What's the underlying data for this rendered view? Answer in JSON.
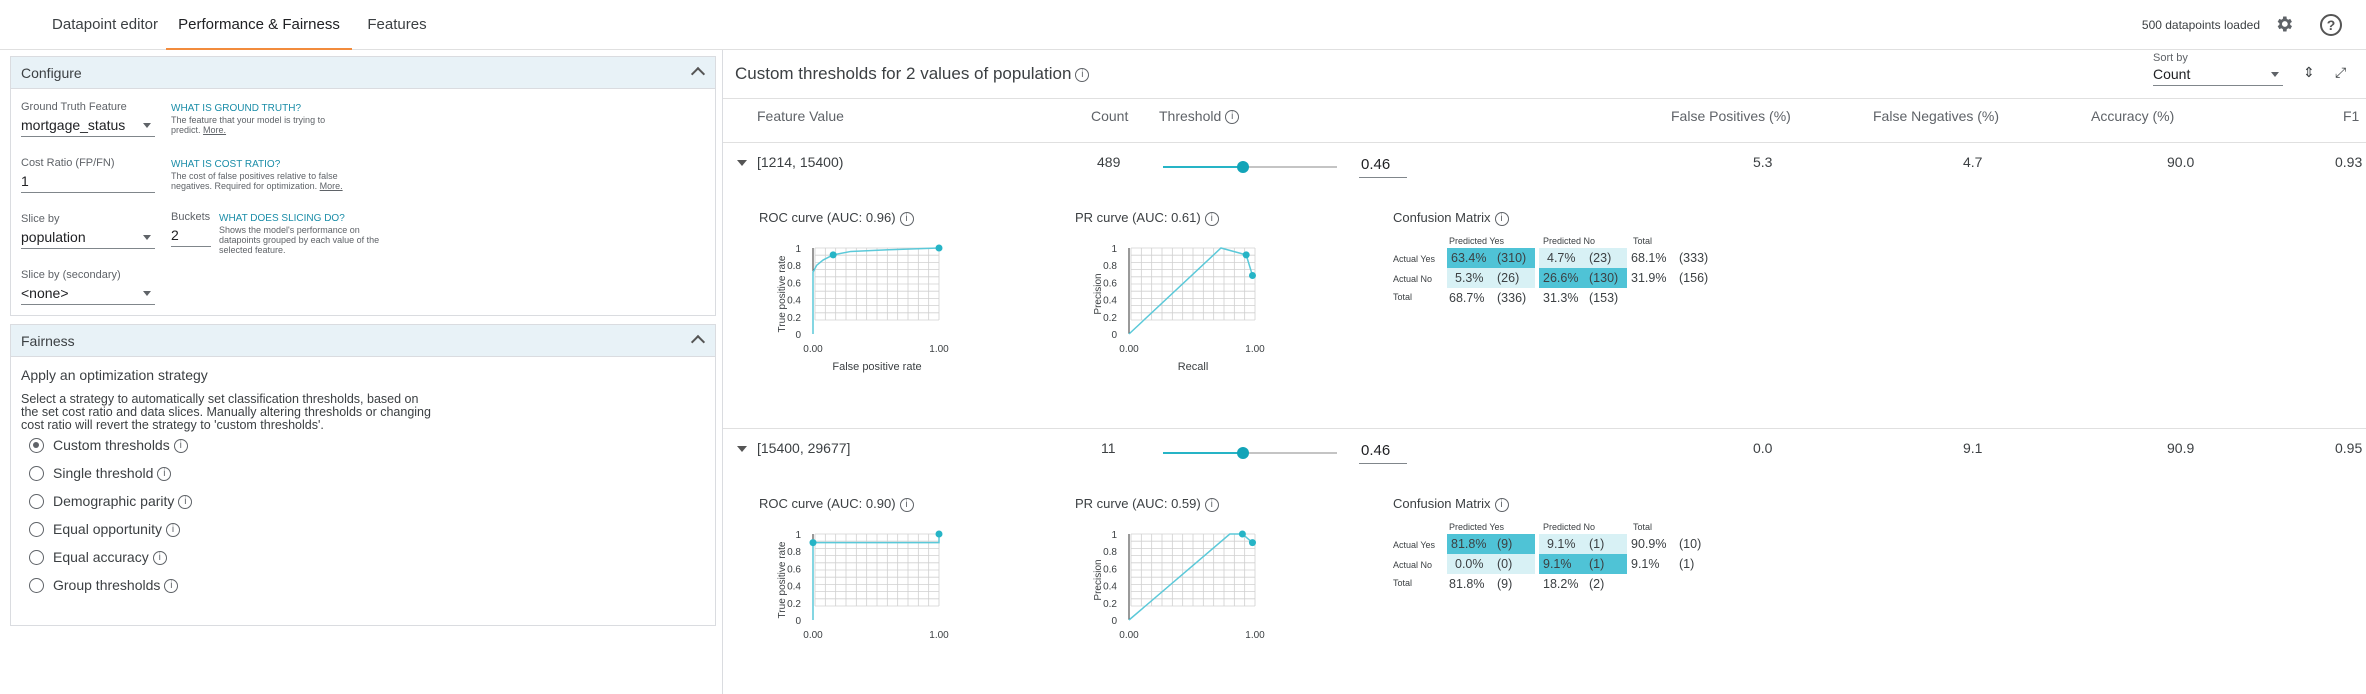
{
  "tabs": [
    "Datapoint editor",
    "Performance & Fairness",
    "Features"
  ],
  "status": {
    "loaded_text": "500 datapoints loaded",
    "settings_icon": "gear-icon",
    "help_icon": "help-icon"
  },
  "configure": {
    "title": "Configure",
    "gt_label": "Ground Truth Feature",
    "gt_value": "mortgage_status",
    "gt_what": "WHAT IS GROUND TRUTH?",
    "gt_desc1": "The feature that your model is trying to",
    "gt_desc2": "predict.",
    "more": "More.",
    "cost_label": "Cost Ratio (FP/FN)",
    "cost_value": "1",
    "cost_what": "WHAT IS COST RATIO?",
    "cost_desc1": "The cost of false positives relative to false",
    "cost_desc2": "negatives. Required for optimization.",
    "slice_label": "Slice by",
    "slice_value": "population",
    "buckets_label": "Buckets",
    "buckets_value": "2",
    "slice_what": "WHAT DOES SLICING DO?",
    "slice_desc1": "Shows the model's performance on",
    "slice_desc2": "datapoints grouped by each value of the",
    "slice_desc3": "selected feature.",
    "slice2_label": "Slice by (secondary)",
    "slice2_value": "<none>"
  },
  "fairness": {
    "title": "Fairness",
    "heading": "Apply an optimization strategy",
    "desc1": "Select a strategy to automatically set classification thresholds, based on",
    "desc2": "the set cost ratio and data slices. Manually altering thresholds or changing",
    "desc3": "cost ratio will revert the strategy to 'custom thresholds'.",
    "options": [
      "Custom thresholds",
      "Single threshold",
      "Demographic parity",
      "Equal opportunity",
      "Equal accuracy",
      "Group thresholds"
    ],
    "selected": "Custom thresholds"
  },
  "main": {
    "title": "Custom thresholds for 2 values of population",
    "sort_label": "Sort by",
    "sort_value": "Count",
    "columns": [
      "Feature Value",
      "Count",
      "Threshold",
      "False Positives (%)",
      "False Negatives (%)",
      "Accuracy (%)",
      "F1"
    ]
  },
  "rows": [
    {
      "feature": "[1214, 15400)",
      "count": "489",
      "threshold": "0.46",
      "threshold_value": 0.46,
      "fp": "5.3",
      "fn": "4.7",
      "acc": "90.0",
      "f1": "0.93",
      "roc_title": "ROC curve (AUC: 0.96)",
      "pr_title": "PR curve (AUC: 0.61)",
      "cm_title": "Confusion Matrix",
      "cm": {
        "h_pred_yes": "Predicted Yes",
        "h_pred_no": "Predicted No",
        "h_total": "Total",
        "r_yes": "Actual Yes",
        "r_no": "Actual No",
        "r_total": "Total",
        "yy_p": "63.4%",
        "yy_c": "(310)",
        "yn_p": "4.7%",
        "yn_c": "(23)",
        "yt_p": "68.1%",
        "yt_c": "(333)",
        "ny_p": "5.3%",
        "ny_c": "(26)",
        "nn_p": "26.6%",
        "nn_c": "(130)",
        "nt_p": "31.9%",
        "nt_c": "(156)",
        "ty_p": "68.7%",
        "ty_c": "(336)",
        "tn_p": "31.3%",
        "tn_c": "(153)"
      }
    },
    {
      "feature": "[15400, 29677]",
      "count": "11",
      "threshold": "0.46",
      "threshold_value": 0.46,
      "fp": "0.0",
      "fn": "9.1",
      "acc": "90.9",
      "f1": "0.95",
      "roc_title": "ROC curve (AUC: 0.90)",
      "pr_title": "PR curve (AUC: 0.59)",
      "cm_title": "Confusion Matrix",
      "cm": {
        "h_pred_yes": "Predicted Yes",
        "h_pred_no": "Predicted No",
        "h_total": "Total",
        "r_yes": "Actual Yes",
        "r_no": "Actual No",
        "r_total": "Total",
        "yy_p": "81.8%",
        "yy_c": "(9)",
        "yn_p": "9.1%",
        "yn_c": "(1)",
        "yt_p": "90.9%",
        "yt_c": "(10)",
        "ny_p": "0.0%",
        "ny_c": "(0)",
        "nn_p": "9.1%",
        "nn_c": "(1)",
        "nt_p": "9.1%",
        "nt_c": "(1)",
        "ty_p": "81.8%",
        "ty_c": "(9)",
        "tn_p": "18.2%",
        "tn_c": "(2)"
      }
    }
  ],
  "axes": {
    "roc_ylabel": "True positive rate",
    "roc_xlabel": "False positive rate",
    "pr_ylabel": "Precision",
    "pr_xlabel": "Recall",
    "yticks": [
      "1",
      "0.8",
      "0.6",
      "0.4",
      "0.2",
      "0"
    ],
    "xticks": [
      "0.00",
      "1.00"
    ]
  },
  "colors": {
    "accent": "#12a4b8",
    "cm_dark": "#4fc3d6",
    "cm_light": "#d8f1f5",
    "tab_underline": "#f28b3c"
  }
}
